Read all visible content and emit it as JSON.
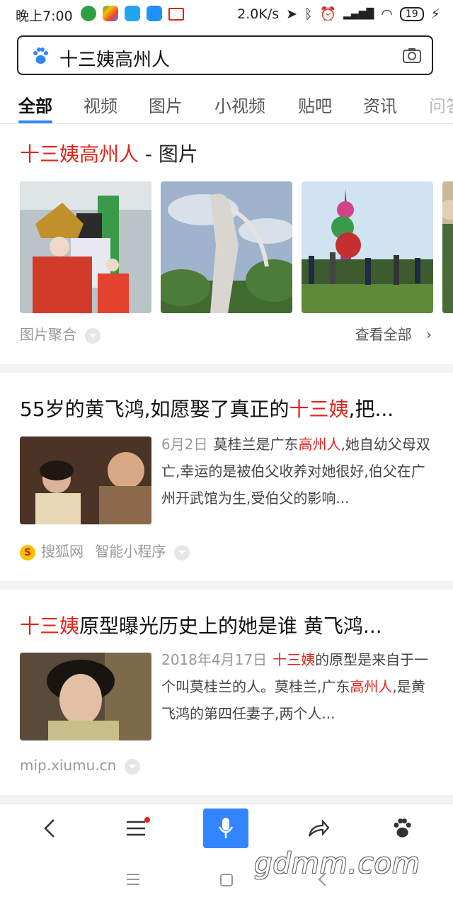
{
  "status_bar": {
    "time": "晚上7:00",
    "network_speed": "2.0K/s",
    "battery": "19",
    "icons": [
      "location-icon",
      "bluetooth-icon",
      "alarm-icon",
      "hd-signal-icon",
      "wifi-icon",
      "battery-icon",
      "charging-icon"
    ]
  },
  "search": {
    "query": "十三姨高州人",
    "logo_icon": "baidu-paw-icon",
    "camera_icon": "camera-icon"
  },
  "tabs": [
    {
      "label": "全部",
      "active": true
    },
    {
      "label": "视频"
    },
    {
      "label": "图片"
    },
    {
      "label": "小视频"
    },
    {
      "label": "贴吧"
    },
    {
      "label": "资讯"
    },
    {
      "label": "问答"
    }
  ],
  "image_card": {
    "title_highlight": "十三姨高州人",
    "title_rest": " - 图片",
    "aggregate_label": "图片聚合",
    "view_all_label": "查看全部"
  },
  "results": [
    {
      "title_pre": "55岁的黄飞鸿,如愿娶了真正的",
      "title_hl": "十三姨",
      "title_post": ",把...",
      "date": "6月2日",
      "snippet_a": "莫桂兰是广东",
      "snippet_hl": "高州人",
      "snippet_b": ",她自幼父母双亡,幸运的是被伯父收养对她很好,伯父在广州开武馆为生,受伯父的影响...",
      "source": "搜狐网",
      "source_extra": "智能小程序"
    },
    {
      "title_pre": "",
      "title_hl": "十三姨",
      "title_post": "原型曝光历史上的她是谁 黄飞鸿...",
      "date": "2018年4月17日",
      "snippet_hl1": "十三姨",
      "snippet_a": "的原型是来自于一个叫莫桂兰的人。莫桂兰,广东",
      "snippet_hl": "高州人",
      "snippet_b": ",是黄飞鸿的第四任妻子,两个人...",
      "source": "mip.xiumu.cn"
    }
  ],
  "bottom_bar": [
    "back-icon",
    "menu-icon",
    "mic-icon",
    "share-icon",
    "baidu-paw-icon"
  ],
  "watermark": "gdmm.com",
  "colors": {
    "accent": "#3388ff",
    "highlight": "#e0241a",
    "muted": "#999999"
  }
}
